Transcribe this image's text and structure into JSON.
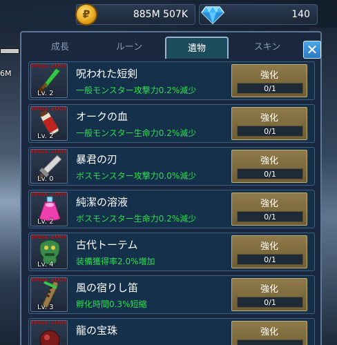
{
  "currency": {
    "gold_symbol": "₽",
    "gold": "885M 507K",
    "gems": "140"
  },
  "background": {
    "left_label": "6M"
  },
  "tabs": [
    {
      "label": "成長"
    },
    {
      "label": "ルーン"
    },
    {
      "label": "遺物"
    },
    {
      "label": "スキン"
    }
  ],
  "active_tab": "遺物",
  "close_symbol": "✕",
  "items": [
    {
      "max": "(Max:200)",
      "level": "Lv. 2",
      "name": "呪われた短剣",
      "desc": "一般モンスター攻撃力0.2%減少",
      "button": "強化",
      "progress": "0/1",
      "icon": "dagger-icon"
    },
    {
      "max": "(Max:200)",
      "level": "Lv. 2",
      "name": "オークの血",
      "desc": "一般モンスター生命力0.2%減少",
      "button": "強化",
      "progress": "0/1",
      "icon": "blood-vial-icon"
    },
    {
      "max": "(Max:200)",
      "level": "Lv. 0",
      "name": "暴君の刃",
      "desc": "ボスモンスター攻撃力0.0%減少",
      "button": "強化",
      "progress": "0/1",
      "icon": "blade-icon"
    },
    {
      "max": "(Max:200)",
      "level": "Lv. 2",
      "name": "純潔の溶液",
      "desc": "ボスモンスター生命力0.2%減少",
      "button": "強化",
      "progress": "0/1",
      "icon": "potion-icon"
    },
    {
      "max": "(Max:200)",
      "level": "Lv. 4",
      "name": "古代トーテム",
      "desc": "装備獲得率2.0%増加",
      "button": "強化",
      "progress": "0/1",
      "icon": "totem-icon"
    },
    {
      "max": "(Max:200)",
      "level": "Lv. 3",
      "name": "風の宿りし笛",
      "desc": "孵化時間0.3%短縮",
      "button": "強化",
      "progress": "0/1",
      "icon": "flute-icon"
    },
    {
      "max": "(Max:200)",
      "level": "",
      "name": "龍の宝珠",
      "desc": "",
      "button": "強化",
      "progress": "",
      "icon": "orb-icon"
    }
  ]
}
